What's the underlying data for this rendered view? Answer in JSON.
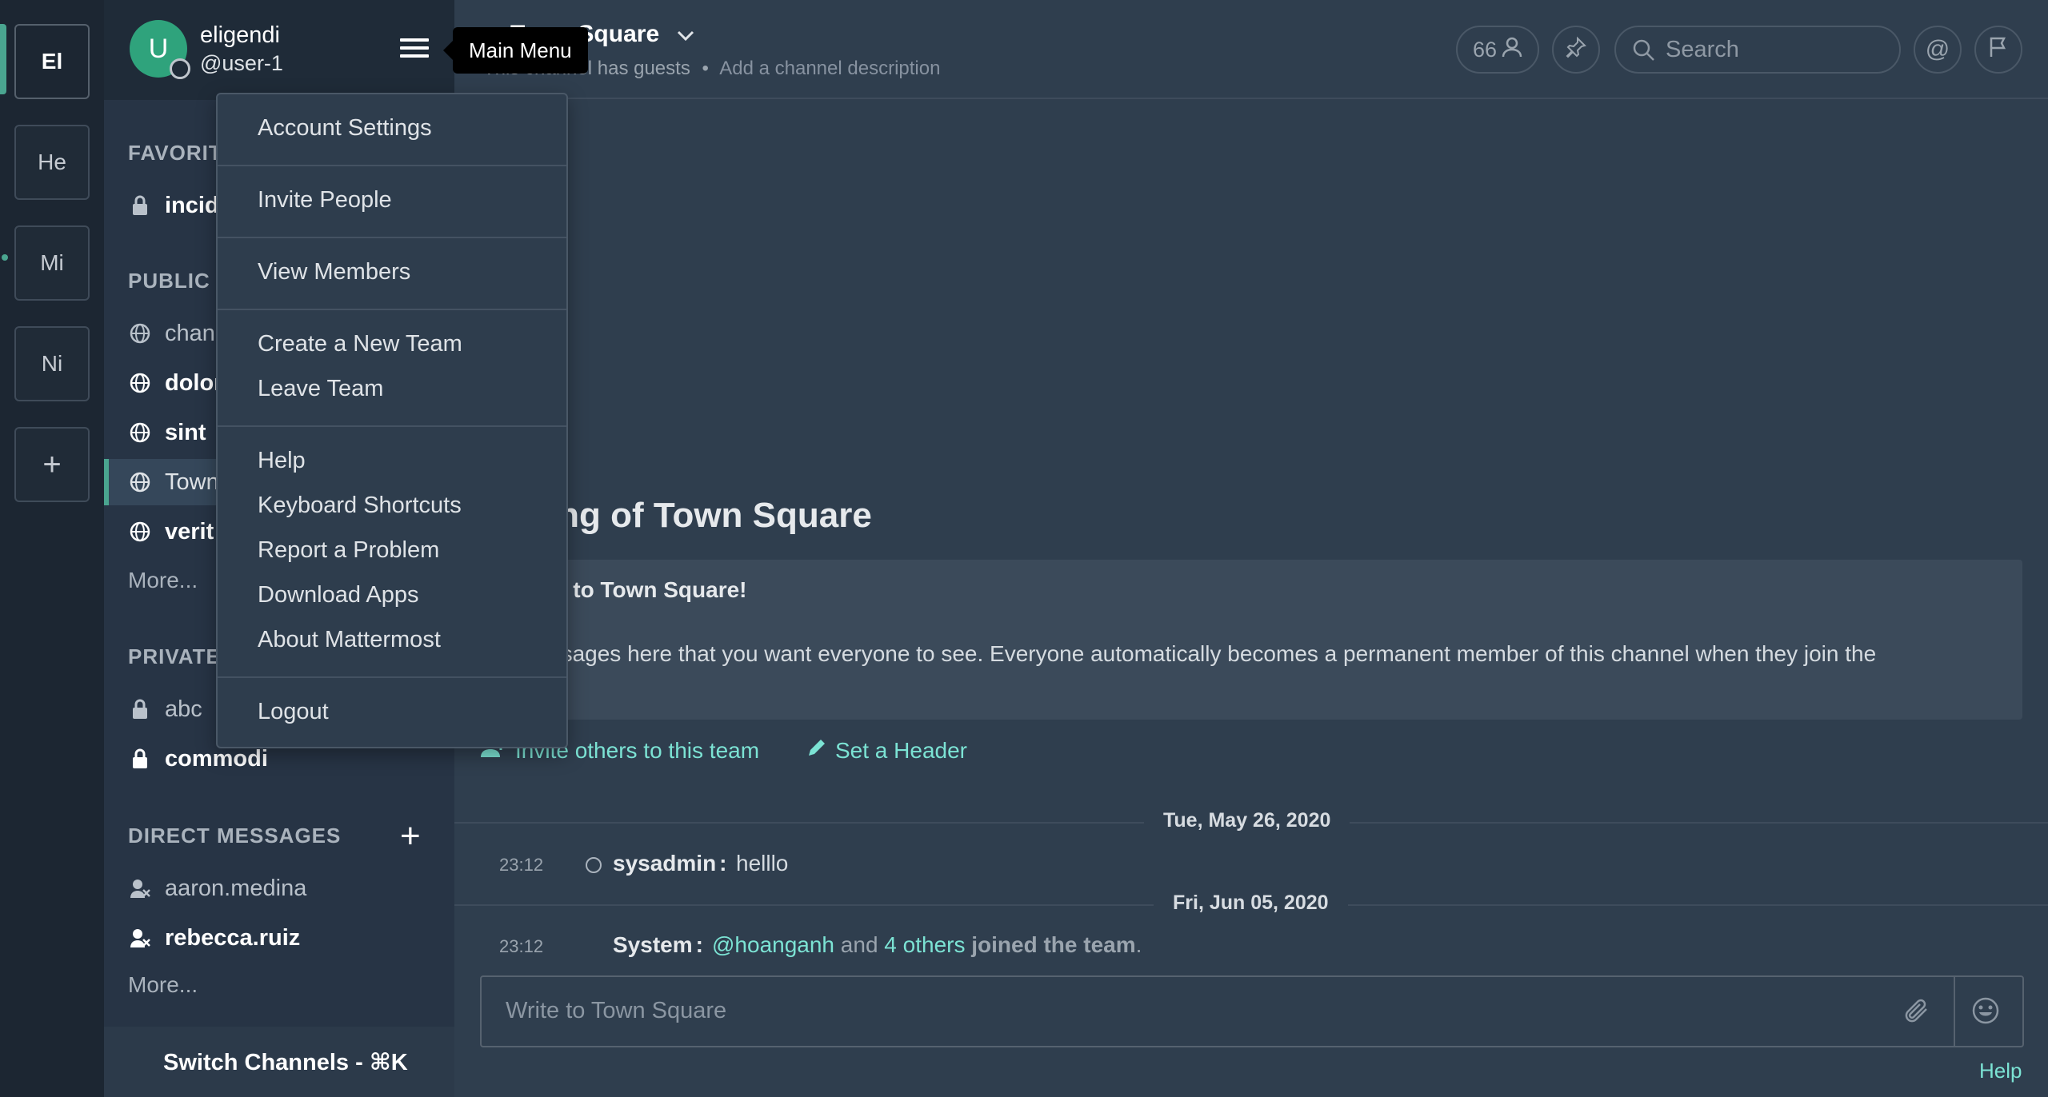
{
  "teams": [
    "El",
    "He",
    "Mi",
    "Ni"
  ],
  "add_team_label": "+",
  "user": {
    "initial": "U",
    "display_name": "eligendi",
    "username": "@user-1"
  },
  "tooltip": "Main Menu",
  "sidebar": {
    "favorites_title": "FAVORIT",
    "favorites": [
      "incid"
    ],
    "public_title": "PUBLIC C",
    "public": [
      "chan",
      "dolor",
      "sint",
      "Town",
      "verit"
    ],
    "public_more": "More...",
    "private_title": "PRIVATE",
    "private": [
      "abc",
      "commodi"
    ],
    "dm_title": "DIRECT MESSAGES",
    "dm_add": "+",
    "dms": [
      "aaron.medina",
      "rebecca.ruiz"
    ],
    "dm_more": "More...",
    "switch": "Switch Channels - ⌘K"
  },
  "main_menu": {
    "items": [
      "Account Settings",
      "Invite People",
      "View Members",
      "Create a New Team",
      "Leave Team",
      "Help",
      "Keyboard Shortcuts",
      "Report a Problem",
      "Download Apps",
      "About Mattermost",
      "Logout"
    ]
  },
  "channel": {
    "name": "Town Square",
    "guests": "This channel has guests",
    "sep": "•",
    "add_desc": "Add a channel description",
    "member_count": "66",
    "search_placeholder": "Search",
    "at_icon": "@"
  },
  "intro": {
    "title": "ning of Town Square",
    "welcome": "me to Town Square!",
    "text": "essages here that you want everyone to see. Everyone automatically becomes a permanent member of this channel when they join the",
    "invite_link": "Invite others to this team",
    "header_link": "Set a Header"
  },
  "posts": {
    "date1": "Tue, May 26, 2020",
    "post1_time": "23:12",
    "post1_user": "sysadmin",
    "post1_colon": ":",
    "post1_text": "helllo",
    "date2": "Fri, Jun 05, 2020",
    "post2_time": "23:12",
    "post2_user": "System",
    "post2_colon": ":",
    "post2_mention": "@hoanganh",
    "post2_and": "and",
    "post2_others": "4 others",
    "post2_joined": "joined the team",
    "post2_period": "."
  },
  "composer": {
    "placeholder": "Write to Town Square"
  },
  "help": "Help",
  "colors": {
    "accent": "#7ce3d4",
    "active_indicator": "#4aa590",
    "avatar": "#2fa37c"
  }
}
